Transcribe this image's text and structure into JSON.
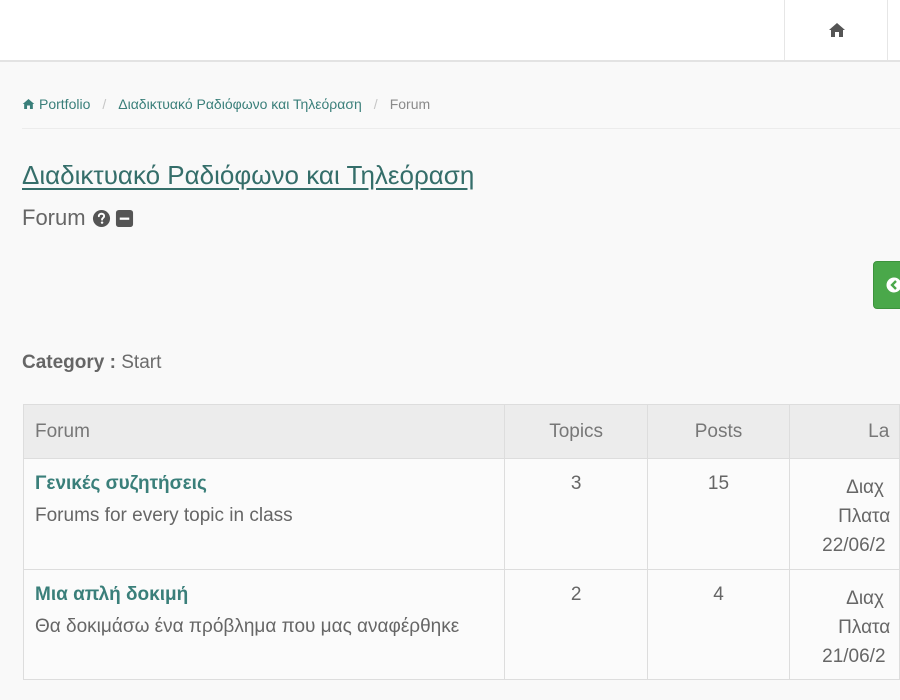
{
  "header": {
    "home_icon": "home-icon"
  },
  "breadcrumb": {
    "items": [
      {
        "label": "Portfolio",
        "icon": "home-icon"
      },
      {
        "label": "Διαδικτυακό Ραδιόφωνο και Τηλεόραση"
      },
      {
        "label": "Forum"
      }
    ],
    "separator": "/"
  },
  "page": {
    "course_title": "Διαδικτυακό Ραδιόφωνο και Τηλεόραση",
    "subtitle": "Forum",
    "help_icon": "question-circle-icon",
    "collapse_icon": "minus-square-icon",
    "action_icon": "arrow-circle-icon"
  },
  "category": {
    "label": "Category :",
    "value": "Start"
  },
  "table": {
    "headers": {
      "forum": "Forum",
      "topics": "Topics",
      "posts": "Posts",
      "last": "La"
    },
    "rows": [
      {
        "name": "Γενικές συζητήσεις",
        "description": "Forums for every topic in class",
        "topics": "3",
        "posts": "15",
        "last_line1": "Διαχ",
        "last_line2": "Πλατα",
        "last_line3": "22/06/2"
      },
      {
        "name": "Μια απλή δοκιμή",
        "description": "Θα δοκιμάσω ένα πρόβλημα που μας αναφέρθηκε",
        "topics": "2",
        "posts": "4",
        "last_line1": "Διαχ",
        "last_line2": "Πλατα",
        "last_line3": "21/06/2"
      }
    ]
  },
  "colors": {
    "link": "#3a7f7a",
    "title": "#356e6a",
    "button_green": "#4aa84a",
    "header_bg": "#ececec"
  }
}
